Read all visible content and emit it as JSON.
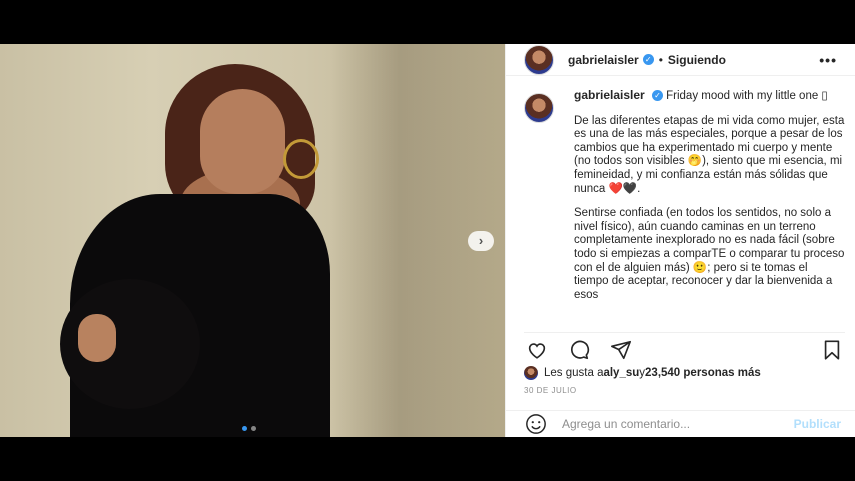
{
  "header": {
    "username": "gabrielaisler",
    "separator": "•",
    "follow_status": "Siguiendo",
    "more_label": "•••"
  },
  "photo": {
    "next_label": "›",
    "carousel_index": 1,
    "carousel_count": 2
  },
  "caption": {
    "username": "gabrielaisler",
    "text_first": "Friday mood with my little one ▯",
    "paragraphs": [
      "De las diferentes etapas de mi vida como mujer, esta es una de las más especiales, porque a pesar de los cambios que ha experimentado mi cuerpo y mente (no todos son visibles 🤭), siento que mi esencia, mi femineidad, y mi confianza están más sólidas que nunca ❤️🖤.",
      "Sentirse confiada (en todos los sentidos, no solo a nivel físico), aún cuando caminas en un terreno completamente inexplorado no es nada fácil (sobre todo si empiezas a comparTE o comparar tu proceso con el de alguien más) 🙂; pero si te tomas el tiempo de aceptar, reconocer y dar la bienvenida a esos"
    ]
  },
  "likes": {
    "prefix": "Les gusta a ",
    "user": "aly_su",
    "middle": " y ",
    "count": "23,540 personas más"
  },
  "date": "30 DE JULIO",
  "comment": {
    "placeholder": "Agrega un comentario...",
    "publish_label": "Publicar"
  },
  "colors": {
    "accent": "#3897f0",
    "publish_disabled": "#b2dffc",
    "border": "#efefef"
  },
  "icons": [
    "verified-badge-icon",
    "heart-icon",
    "comment-icon",
    "share-icon",
    "bookmark-icon",
    "emoji-icon",
    "chevron-right-icon"
  ]
}
